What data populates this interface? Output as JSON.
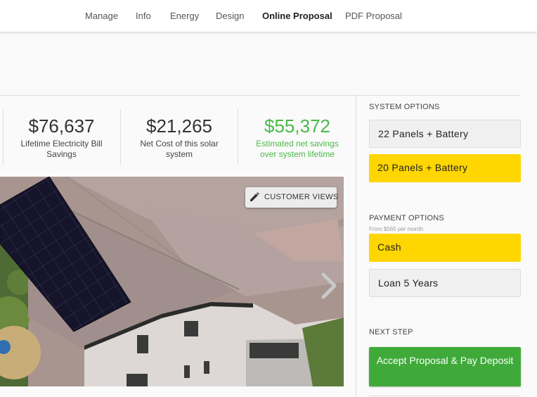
{
  "nav": {
    "tabs": [
      {
        "label": "Manage"
      },
      {
        "label": "Info"
      },
      {
        "label": "Energy"
      },
      {
        "label": "Design"
      },
      {
        "label": "Online Proposal"
      },
      {
        "label": "PDF Proposal"
      }
    ],
    "active_tab": "Online Proposal"
  },
  "stats": [
    {
      "value": "$76,637",
      "label": "Lifetime Electricity Bill Savings"
    },
    {
      "value": "$21,265",
      "label": "Net Cost of this solar system"
    },
    {
      "value": "$55,372",
      "label": "Estimated net savings over system lifetime",
      "color": "#4cb848"
    }
  ],
  "photo": {
    "customer_views_label": "CUSTOMER VIEWS",
    "edit_icon": "pencil-icon",
    "next_icon": "chevron-right-icon"
  },
  "sidebar": {
    "system_options": {
      "heading": "SYSTEM OPTIONS",
      "options": [
        {
          "label": "22 Panels + Battery",
          "selected": false
        },
        {
          "label": "20 Panels + Battery",
          "selected": true
        }
      ]
    },
    "payment_options": {
      "heading": "PAYMENT OPTIONS",
      "subtext": "From $565 per month",
      "options": [
        {
          "label": "Cash",
          "selected": true
        },
        {
          "label": "Loan 5 Years",
          "selected": false
        }
      ]
    },
    "next_step": {
      "heading": "NEXT STEP",
      "button_label": "Accept Proposal & Pay Deposit"
    }
  },
  "colors": {
    "selected": "#ffd600",
    "accept": "#3faa3a",
    "savings": "#4cb848"
  }
}
